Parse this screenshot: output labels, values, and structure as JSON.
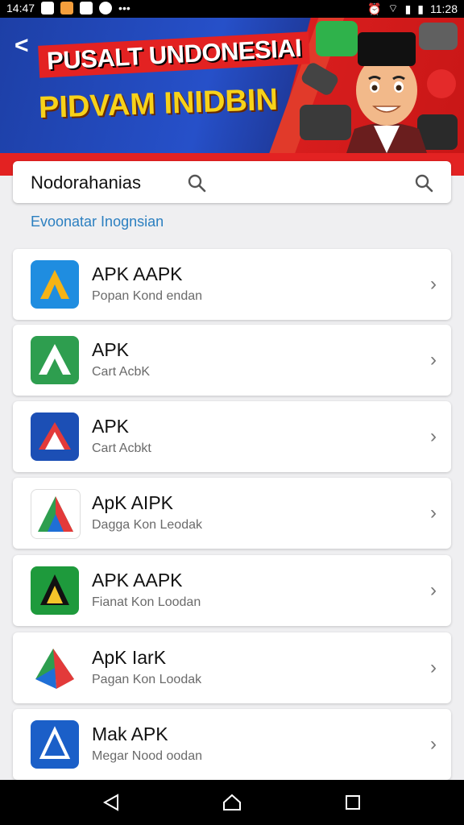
{
  "status": {
    "time_left": "14:47",
    "time_right": "11:28"
  },
  "banner": {
    "back": "<",
    "title1": "PUSALT UNDONESIAI",
    "title2": "PIDVAM INIDBIN"
  },
  "search": {
    "text": "Nodorahanias"
  },
  "section": {
    "title": "Evoonatar Inognsian"
  },
  "apps": [
    {
      "name": "APK  AAPK",
      "subtitle": "Popan Kond endan"
    },
    {
      "name": "APK",
      "subtitle": "Cart AcbK"
    },
    {
      "name": "APK",
      "subtitle": "Cart Acbkt"
    },
    {
      "name": "ApK  AIPK",
      "subtitle": "Dagga Kon Leodak"
    },
    {
      "name": "APK  AAPK",
      "subtitle": "Fianat Kon Loodan"
    },
    {
      "name": "ApK  IarK",
      "subtitle": "Pagan Kon Loodak"
    },
    {
      "name": "Mak APK",
      "subtitle": "Megar Nood oodan"
    }
  ],
  "colors": {
    "accent": "#e32222",
    "banner_blue": "#1d3fa6",
    "link": "#2b7fc0"
  }
}
